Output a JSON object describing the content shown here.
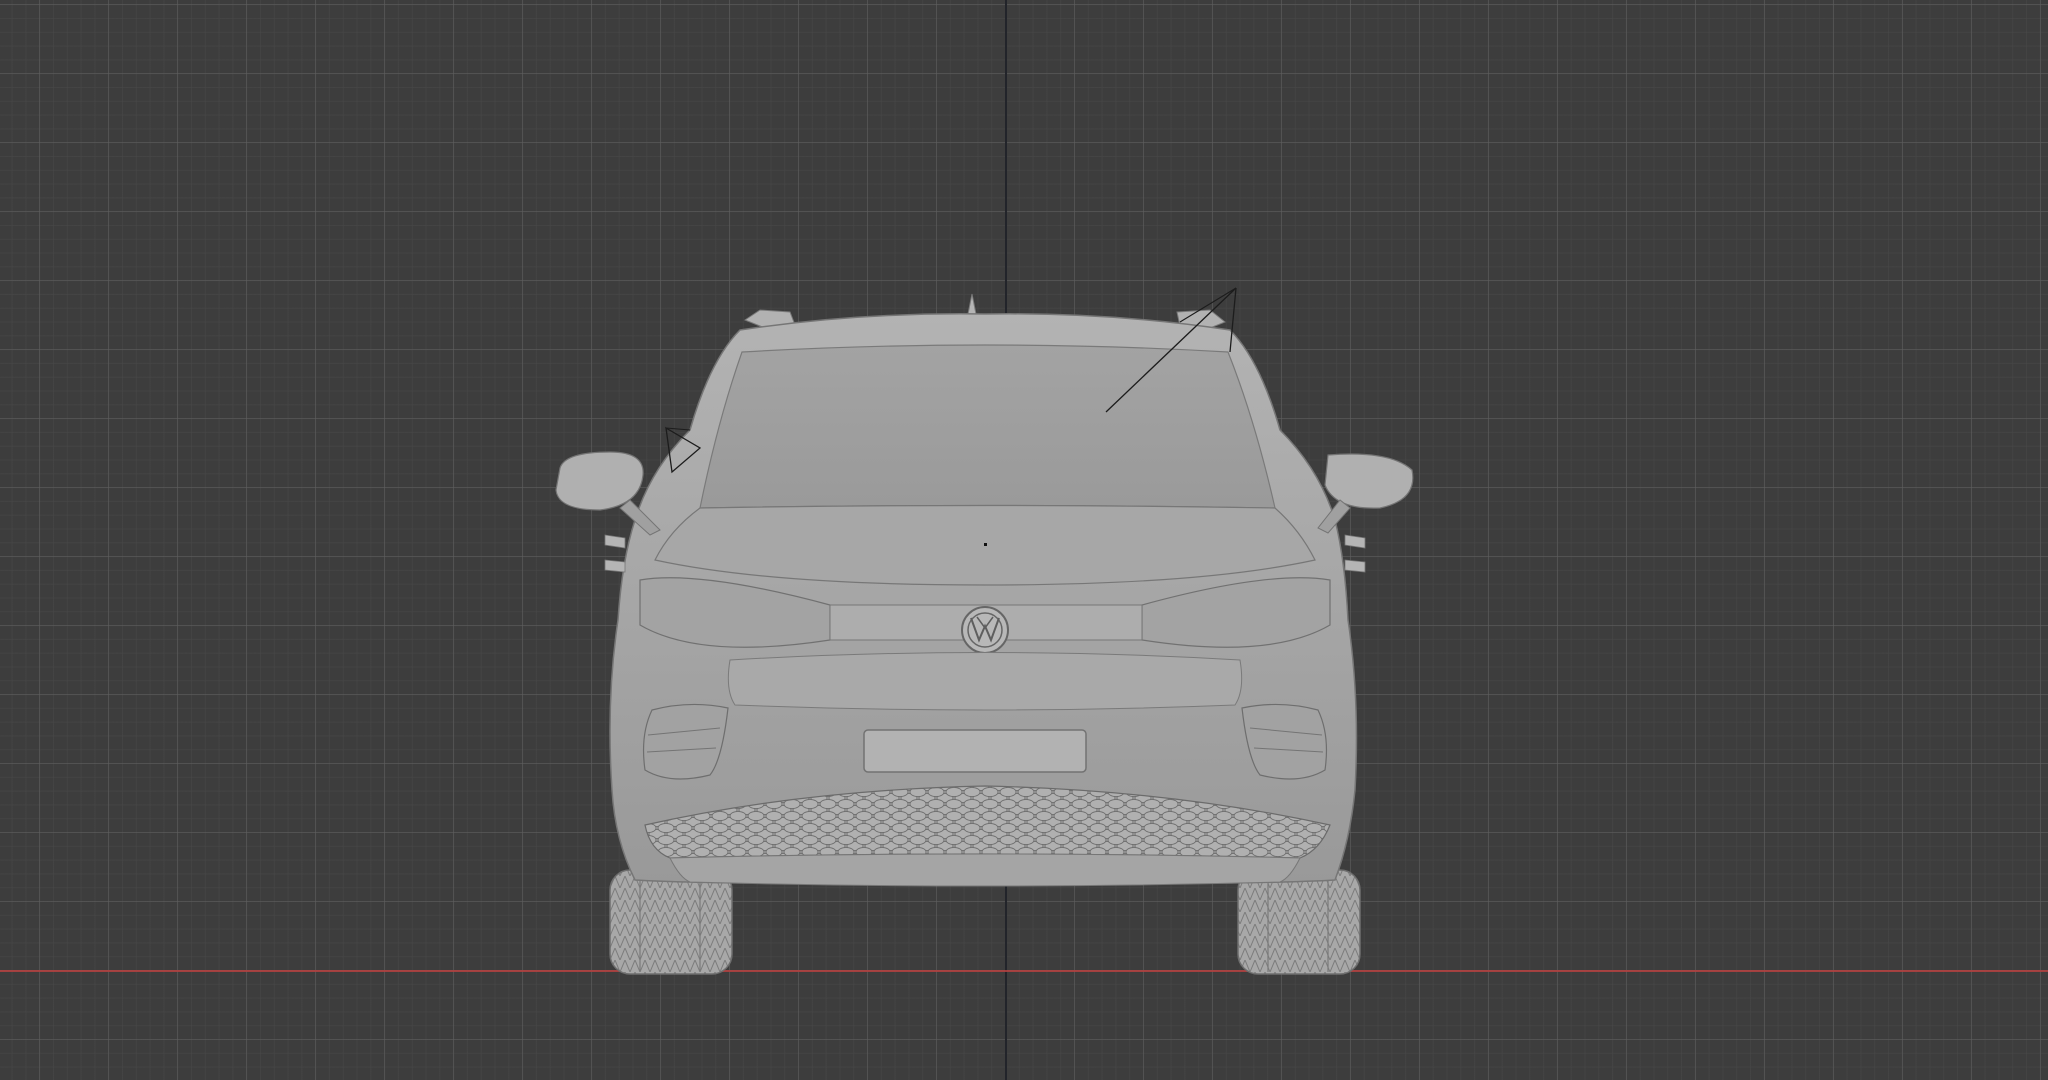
{
  "viewport": {
    "view": "front-orthographic",
    "object": "car-model",
    "shading": "solid",
    "colors": {
      "background": "#3d3d3d",
      "grid_major": "#5f5f5f",
      "grid_minor": "#484848",
      "x_axis": "#b5413f",
      "z_axis": "#22242a",
      "model": "#a9a9a9"
    },
    "icons": [
      "light-object-icon",
      "camera-object-icon",
      "origin-point-icon",
      "vw-emblem-icon"
    ]
  }
}
